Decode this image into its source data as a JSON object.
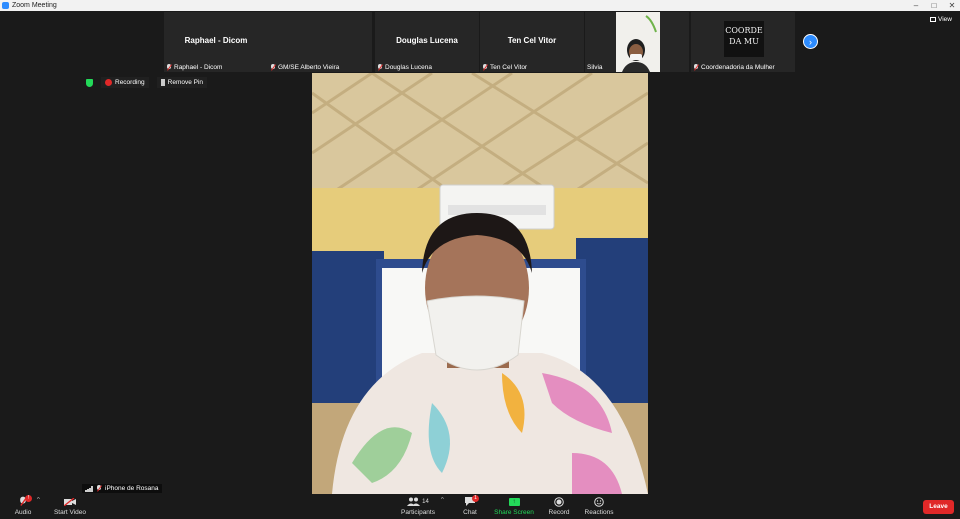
{
  "window": {
    "title": "Zoom Meeting",
    "controls": [
      "minimize",
      "maximize",
      "close"
    ]
  },
  "view_button": {
    "label": "View",
    "icon": "grid-view-icon"
  },
  "participants_strip": [
    {
      "name": "Raphael - Dicom",
      "label": "Raphael - Dicom",
      "muted": true,
      "video": false
    },
    {
      "name": "GM/SE Alberto Vieira",
      "label": "GM/SE Alberto Vieira",
      "muted": true,
      "video": true
    },
    {
      "name": "Douglas Lucena",
      "label": "Douglas Lucena",
      "muted": true,
      "video": false
    },
    {
      "name": "Ten Cel Vitor",
      "label": "Ten Cel Vitor",
      "muted": true,
      "video": false
    },
    {
      "name": "Silvia",
      "label": "Silvia",
      "muted": false,
      "video": true
    },
    {
      "name": "Coordenadoria da Mulher",
      "label": "Coordenadoria da Mulher",
      "muted": true,
      "video": true,
      "video_text_line1": "COORDE",
      "video_text_line2": "DA MU"
    }
  ],
  "status_bar": {
    "recording_label": "Recording",
    "unpin_label": "Remove Pin"
  },
  "self_view": {
    "name": "iPhone de Rosana"
  },
  "toolbar": {
    "audio_label": "Audio",
    "start_video_label": "Start Video",
    "participants_label": "Participants",
    "participants_count": "14",
    "chat_label": "Chat",
    "chat_badge": "1",
    "share_label": "Share Screen",
    "record_label": "Record",
    "reactions_label": "Reactions",
    "leave_label": "Leave"
  },
  "colors": {
    "accent": "#2d8cff",
    "share_green": "#23d959",
    "leave_red": "#e02828",
    "background": "#1a1a1a"
  }
}
